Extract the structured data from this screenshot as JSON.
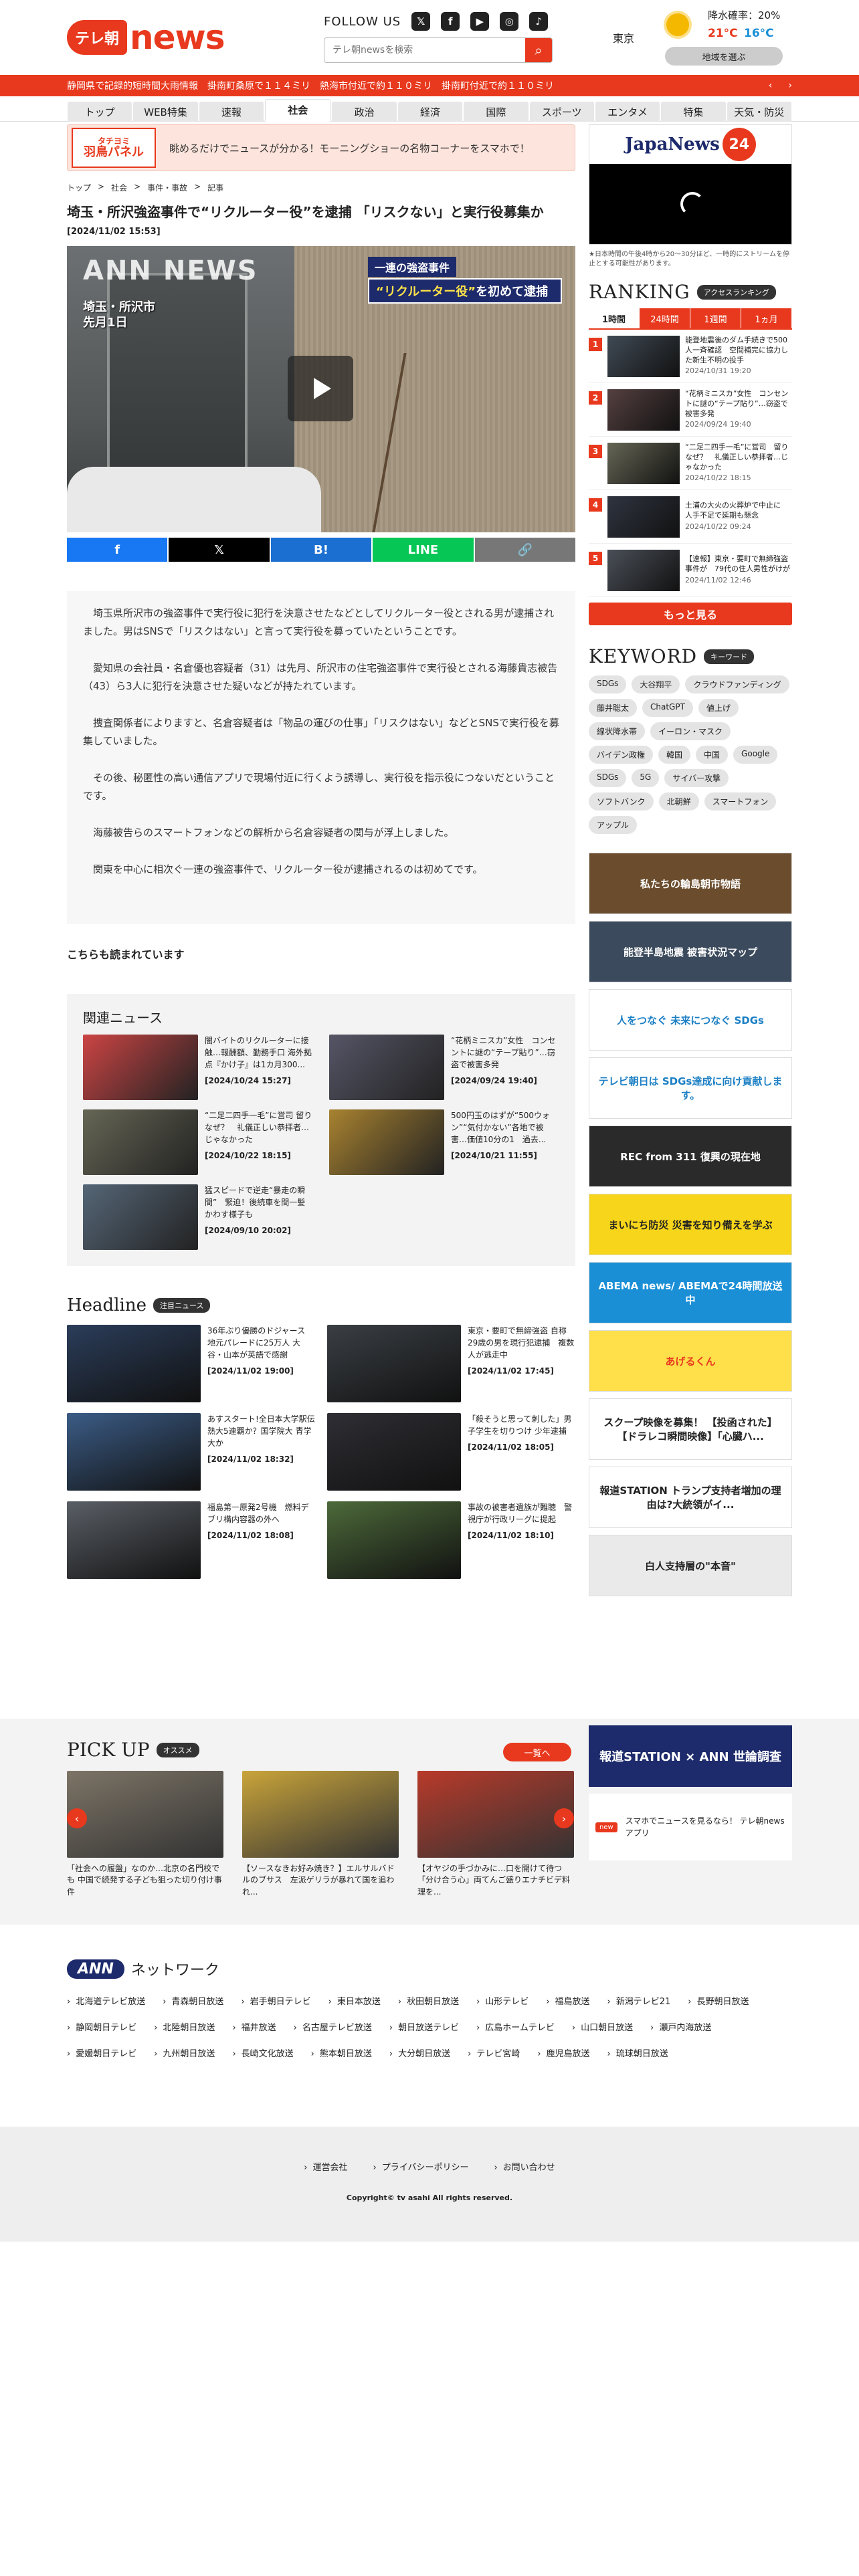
{
  "header": {
    "logo_mark": "テレ朝",
    "logo_news": "news",
    "follow_label": "FOLLOW US",
    "sns": [
      {
        "name": "x-icon",
        "glyph": "𝕏"
      },
      {
        "name": "facebook-icon",
        "glyph": "f"
      },
      {
        "name": "youtube-icon",
        "glyph": "▶"
      },
      {
        "name": "instagram-icon",
        "glyph": "◎"
      },
      {
        "name": "tiktok-icon",
        "glyph": "♪"
      }
    ],
    "search_placeholder": "テレ朝newsを検索",
    "search_icon": "search-icon",
    "weather": {
      "city": "東京",
      "rain": "降水確率：20%",
      "high": "21°C",
      "low": "16°C",
      "select_button": "地域を選ぶ",
      "icon": "sun-icon"
    }
  },
  "ticker": {
    "text": "静岡県で記録的短時間大雨情報　掛南町桑原で１１４ミリ　熱海市付近で約１１０ミリ　掛南町付近で約１１０ミリ",
    "prev": "‹",
    "next": "›"
  },
  "nav": [
    "トップ",
    "WEB特集",
    "速報",
    "社会",
    "政治",
    "経済",
    "国際",
    "スポーツ",
    "エンタメ",
    "特集",
    "天気・防災"
  ],
  "nav_active": "社会",
  "banner": {
    "tag_line1": "タチヨミ",
    "tag_line2": "羽鳥パネル",
    "text": "眺めるだけでニュースが分かる！モーニングショーの名物コーナーをスマホで！"
  },
  "breadcrumb": [
    "トップ",
    "社会",
    "事件・事故",
    "記事"
  ],
  "article": {
    "title": "埼玉・所沢強盗事件で“リクルーター役”を逮捕 「リスクない」と実行役募集か",
    "date": "[2024/11/02 15:53]",
    "video": {
      "watermark": "ANN NEWS",
      "location_line1": "埼玉・所沢市",
      "location_line2": "先月1日",
      "caption_line1": "一連の強盗事件",
      "caption_highlight": "“リクルーター役”",
      "caption_rest": "を初めて逮捕"
    },
    "share": [
      {
        "name": "facebook-share-button",
        "label": "f",
        "color": "#1877f2"
      },
      {
        "name": "x-share-button",
        "label": "𝕏",
        "color": "#000000"
      },
      {
        "name": "hatena-share-button",
        "label": "B!",
        "color": "#1b6fd1"
      },
      {
        "name": "line-share-button",
        "label": "LINE",
        "color": "#06c755"
      },
      {
        "name": "copy-link-button",
        "label": "🔗",
        "color": "#777777"
      }
    ],
    "paragraphs": [
      "埼玉県所沢市の強盗事件で実行役に犯行を決意させたなどとしてリクルーター役とされる男が逮捕されました。男はSNSで「リスクはない」と言って実行役を募っていたということです。",
      "愛知県の会社員・名倉優也容疑者（31）は先月、所沢市の住宅強盗事件で実行役とされる海藤貴志被告（43）ら3人に犯行を決意させた疑いなどが持たれています。",
      "捜査関係者によりますと、名倉容疑者は「物品の運びの仕事」「リスクはない」などとSNSで実行役を募集していました。",
      "その後、秘匿性の高い通信アプリで現場付近に行くよう誘導し、実行役を指示役につないだということです。",
      "海藤被告らのスマートフォンなどの解析から名倉容疑者の関与が浮上しました。",
      "関東を中心に相次ぐ一連の強盗事件で、リクルーター役が逮捕されるのは初めてです。"
    ]
  },
  "recommend_heading": "こちらも読まれています",
  "related": {
    "heading": "関連ニュース",
    "items": [
      {
        "title": "闇バイトのリクルーターに接触…報酬額、勤務手口 海外拠点『かけ子』は1カ月300...",
        "date": "[2024/10/24 15:27]",
        "color": "#c44"
      },
      {
        "title": "“花柄ミニスカ”女性　コンセントに謎の“テープ貼り”…窃盗で被害多発",
        "date": "[2024/09/24 19:40]",
        "color": "#556"
      },
      {
        "title": "“二足二四手一毛”に営司 留り　なぜ？　礼儀正しい恭拝者…じゃなかった",
        "date": "[2024/10/22 18:15]",
        "color": "#665"
      },
      {
        "title": "500円玉のはずが“500ウォン”“気付かない”各地で被害…価値10分の1　過去...",
        "date": "[2024/10/21 11:55]",
        "color": "#a88230"
      },
      {
        "title": "猛スピードで逆走“暴走の瞬間”　緊迫！後続車を間一髪かわす様子も",
        "date": "[2024/09/10 20:02]",
        "color": "#567"
      }
    ]
  },
  "headline": {
    "heading": "Headline",
    "pill": "注目ニュース",
    "items": [
      {
        "title": "36年ぶり優勝のドジャース 地元パレードに25万人 大谷・山本が英語で感謝",
        "date": "[2024/11/02 19:00]",
        "color": "#2b3d5a"
      },
      {
        "title": "東京・要町で無締強盗 自称29歳の男を現行犯逮捕　複数人が逃走中",
        "date": "[2024/11/02 17:45]",
        "color": "#3a3f44"
      },
      {
        "title": "あすスタート!全日本大学駅伝　熱大5連覇か？国学院大 青学大か",
        "date": "[2024/11/02 18:32]",
        "color": "#3b5c86"
      },
      {
        "title": "「殺そうと思って刺した」男子学生を切りつけ 少年逮捕",
        "date": "[2024/11/02 18:05]",
        "color": "#2e2e34"
      },
      {
        "title": "福島第一原発2号機　燃料デブリ構内容器の外へ",
        "date": "[2024/11/02 18:08]",
        "color": "#5a5f66"
      },
      {
        "title": "事故の被害者遺族が難聴　警視庁が行政リーグに提起",
        "date": "[2024/11/02 18:10]",
        "color": "#4d6a3a"
      }
    ]
  },
  "sidebar": {
    "jn24_text": "JapaNews",
    "jn24_num": "24",
    "jn24_note": "★日本時間の午後4時から20〜30分ほど、一時的にストリームを停止とする可能性があります。",
    "ranking_heading": "RANKING",
    "ranking_pill": "アクセスランキング",
    "ranking_tabs": [
      "1時間",
      "24時間",
      "1週間",
      "1ヵ月"
    ],
    "ranking_items": [
      {
        "num": "1",
        "title": "能登地震後のダム手続きで500人一斉確認　空間補完に協力した新生不明の投手",
        "date": "2024/10/31 19:20",
        "color": "#404a55"
      },
      {
        "title": "“花柄ミニスカ”女性　コンセントに謎の“テープ貼り”…窃盗で被害多発",
        "num": "2",
        "date": "2024/09/24 19:40",
        "color": "#554040"
      },
      {
        "num": "3",
        "title": "“二足二四手一毛”に営司　留り　なぜ？　礼儀正しい恭拝者…じゃなかった",
        "date": "2024/10/22 18:15",
        "color": "#665"
      },
      {
        "num": "4",
        "title": "土浦の大火の火葬炉で中止に　人手不足で延期も懸念",
        "date": "2024/10/22 09:24",
        "color": "#2f3440"
      },
      {
        "num": "5",
        "title": "【速報】東京・要町で無締強盗事件が　79代の住人男性がけが",
        "date": "2024/11/02 12:46",
        "color": "#4a4f58"
      }
    ],
    "more_label": "もっと見る",
    "keyword_heading": "KEYWORD",
    "keyword_pill": "キーワード",
    "keywords": [
      "SDGs",
      "大谷翔平",
      "クラウドファンディング",
      "藤井聡太",
      "ChatGPT",
      "値上げ",
      "線状降水帯",
      "イーロン・マスク",
      "バイデン政権",
      "韓国",
      "中国",
      "Google",
      "SDGs",
      "5G",
      "サイバー攻撃",
      "ソフトバンク",
      "北朝鮮",
      "スマートフォン",
      "アップル"
    ],
    "ads": [
      {
        "name": "ad-wajima",
        "label": "私たちの輪島朝市物語",
        "bg": "#6b4d2d",
        "fg": "#ffffff"
      },
      {
        "name": "ad-noto-map",
        "label": "能登半島地震 被害状況マップ",
        "bg": "#3b4a5c",
        "fg": "#ffffff"
      },
      {
        "name": "ad-sdgs",
        "label": "人をつなぐ 未来につなぐ SDGs",
        "bg": "#ffffff",
        "fg": "#1b7fc4"
      },
      {
        "name": "ad-tvasahi-sdgs",
        "label": "テレビ朝日は SDGs達成に向け貢献します。",
        "bg": "#ffffff",
        "fg": "#1b7fc4"
      },
      {
        "name": "ad-rec311",
        "label": "REC from 311 復興の現在地",
        "bg": "#2a2a2a",
        "fg": "#ffffff"
      },
      {
        "name": "ad-bousai",
        "label": "まいにち防災 災害を知り備えを学ぶ",
        "bg": "#f6d51a",
        "fg": "#222222"
      },
      {
        "name": "ad-abema",
        "label": "ABEMA news/ ABEMAで24時間放送中",
        "bg": "#1a8fd6",
        "fg": "#ffffff"
      },
      {
        "name": "ad-ageruku",
        "label": "あげるくん",
        "bg": "#ffe04a",
        "fg": "#e8391e"
      },
      {
        "name": "ad-scoop",
        "label": "スクープ映像を募集！ 【投函された】【ドラレコ瞬間映像】「心臓ハ...",
        "bg": "#ffffff",
        "fg": "#222222"
      },
      {
        "name": "ad-hodo-station",
        "label": "報道STATION トランプ支持者増加の理由は?大統領がイ...",
        "bg": "#ffffff",
        "fg": "#222222"
      },
      {
        "name": "ad-bakumasu",
        "label": "白人支持層の\"本音\"",
        "bg": "#eaeaea",
        "fg": "#222222"
      }
    ],
    "poll_label": "報道STATION × ANN 世論調査",
    "app_label": "スマホでニュースを見るなら！ テレ朝newsアプリ",
    "app_badge": "new"
  },
  "pickup": {
    "heading": "PICK UP",
    "pill": "オススメ",
    "all_label": "一覧へ",
    "items": [
      {
        "title": "「社会への履盤」なのか…北京の名門校でも 中国で続発する子ども狙った切り付け事件",
        "color": "#7d7466"
      },
      {
        "title": "【ソースなきお好み焼き？】エルサルバドルのブサス　左派ゲリラが暴れて国を追われ...",
        "color": "#c9a43a"
      },
      {
        "title": "【オヤジの手づかみに…口を開けて待つ「分け合う心」両てんご盛りエナチビデ料理を...",
        "color": "#b83a2a"
      }
    ],
    "prev": "‹",
    "next": "›"
  },
  "ann": {
    "logo": "ANN",
    "title": "ネットワーク",
    "links": [
      "北海道テレビ放送",
      "青森朝日放送",
      "岩手朝日テレビ",
      "東日本放送",
      "秋田朝日放送",
      "山形テレビ",
      "福島放送",
      "新潟テレビ21",
      "長野朝日放送",
      "静岡朝日テレビ",
      "北陸朝日放送",
      "福井放送",
      "名古屋テレビ放送",
      "朝日放送テレビ",
      "広島ホームテレビ",
      "山口朝日放送",
      "瀬戸内海放送",
      "愛媛朝日テレビ",
      "九州朝日放送",
      "長崎文化放送",
      "熊本朝日放送",
      "大分朝日放送",
      "テレビ宮崎",
      "鹿児島放送",
      "琉球朝日放送"
    ]
  },
  "footer": {
    "links": [
      "運営会社",
      "プライバシーポリシー",
      "お問い合わせ"
    ],
    "copyright": "Copyright© tv asahi All rights reserved."
  }
}
